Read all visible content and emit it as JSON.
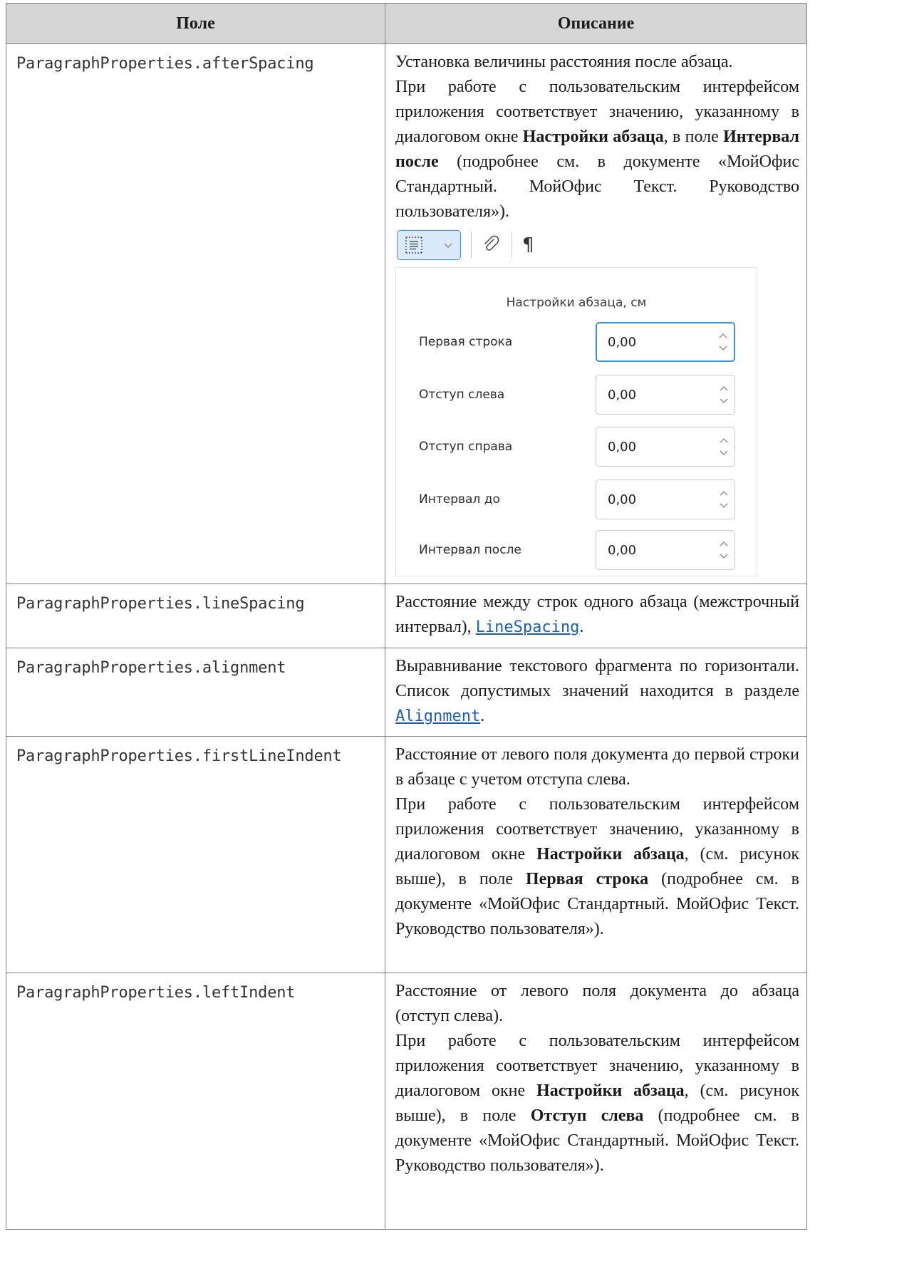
{
  "table": {
    "headers": [
      "Поле",
      "Описание"
    ],
    "row1": {
      "field": "ParagraphProperties.afterSpacing",
      "p1": "Установка величины расстояния после абзаца.",
      "p2_a": "При работе с пользовательским интерфейсом приложения соответствует значению, указанному в диалоговом окне ",
      "p2_b1": "Настройки абзаца",
      "p2_c": ", в поле ",
      "p2_b2": "Интервал после",
      "p2_d": " (подробнее см. в документе «МойОфис Стандартный. МойОфис Текст. Руководство пользователя»)."
    },
    "row2": {
      "field": "ParagraphProperties.lineSpacing",
      "text": "Расстояние между строк одного абзаца (межстрочный интервал), ",
      "link": "LineSpacing",
      "tail": "."
    },
    "row3": {
      "field": "ParagraphProperties.alignment",
      "text": "Выравнивание текстового фрагмента по горизонтали. Список допустимых значений находится в разделе ",
      "link": "Alignment",
      "tail": "."
    },
    "row4": {
      "field": "ParagraphProperties.firstLineIndent",
      "p1": "Расстояние от левого поля документа до первой строки в абзаце с учетом отступа слева.",
      "p2_a": "При работе с пользовательским интерфейсом приложения соответствует значению, указанному в диалоговом окне ",
      "p2_b1": "Настройки абзаца",
      "p2_c": ", (см. рисунок выше), в поле ",
      "p2_b2": "Первая строка",
      "p2_d": " (подробнее см. в документе «МойОфис Стандартный. МойОфис Текст. Руководство пользователя»)."
    },
    "row5": {
      "field": "ParagraphProperties.leftIndent",
      "p1": "Расстояние от левого поля документа до абзаца (отступ слева).",
      "p2_a": "При работе с пользовательским интерфейсом приложения соответствует значению, указанному в диалоговом окне ",
      "p2_b1": "Настройки абзаца",
      "p2_c": ", (см. рисунок выше), в поле ",
      "p2_b2": "Отступ слева",
      "p2_d": " (подробнее см. в документе «МойОфис Стандартный. МойОфис Текст. Руководство пользователя»)."
    }
  },
  "screenshot": {
    "toolbar": {
      "icons": [
        "paragraph-settings-icon",
        "chevron-down-icon",
        "link-icon",
        "pilcrow-icon"
      ],
      "pilcrow": "¶"
    },
    "panel": {
      "title": "Настройки абзаца, см",
      "fields": [
        {
          "label": "Первая строка",
          "value": "0,00",
          "active": true
        },
        {
          "label": "Отступ слева",
          "value": "0,00",
          "active": false
        },
        {
          "label": "Отступ справа",
          "value": "0,00",
          "active": false
        },
        {
          "label": "Интервал до",
          "value": "0,00",
          "active": false
        },
        {
          "label": "Интервал после",
          "value": "0,00",
          "active": false
        }
      ]
    }
  },
  "colors": {
    "header_bg": "#d6d6d6",
    "border": "#7f7f7f",
    "link": "#1a5fb4",
    "accent": "#3f8fd8",
    "button_bg": "#dbeafb"
  }
}
